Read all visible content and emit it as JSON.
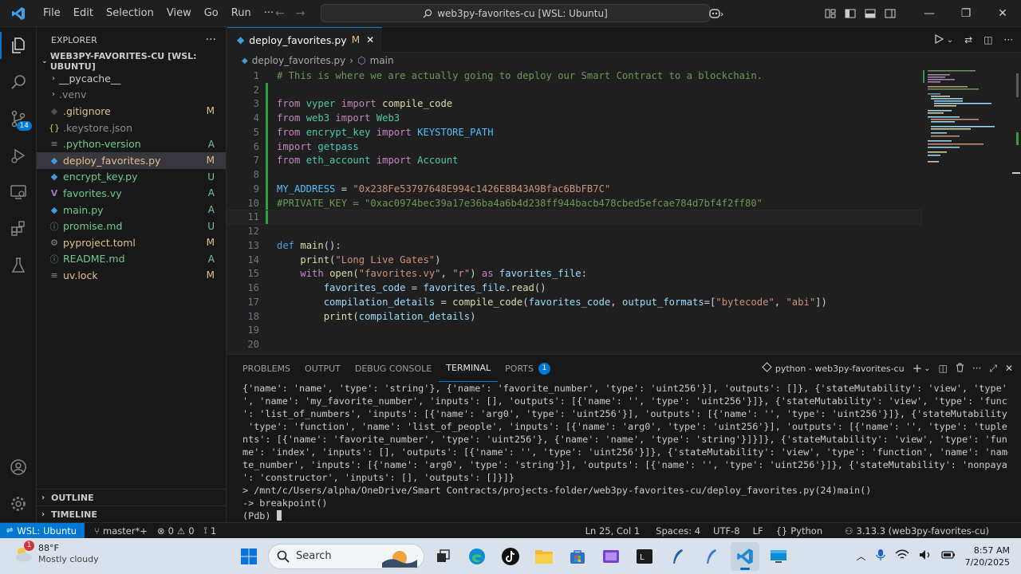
{
  "titlebar": {
    "menu": [
      "File",
      "Edit",
      "Selection",
      "View",
      "Go",
      "Run",
      "···"
    ],
    "command_center": "web3py-favorites-cu [WSL: Ubuntu]"
  },
  "activity": {
    "scm_badge": "14"
  },
  "explorer": {
    "title": "EXPLORER",
    "project": "WEB3PY-FAVORITES-CU [WSL: UBUNTU]",
    "items": [
      {
        "name": "__pycache__",
        "status": "",
        "type": "folder"
      },
      {
        "name": ".venv",
        "status": "",
        "type": "folder"
      },
      {
        "name": ".gitignore",
        "status": "M",
        "type": "git"
      },
      {
        "name": ".keystore.json",
        "status": "",
        "type": "json"
      },
      {
        "name": ".python-version",
        "status": "A",
        "type": "text"
      },
      {
        "name": "deploy_favorites.py",
        "status": "M",
        "type": "py"
      },
      {
        "name": "encrypt_key.py",
        "status": "U",
        "type": "py"
      },
      {
        "name": "favorites.vy",
        "status": "A",
        "type": "vy"
      },
      {
        "name": "main.py",
        "status": "A",
        "type": "py"
      },
      {
        "name": "promise.md",
        "status": "U",
        "type": "md"
      },
      {
        "name": "pyproject.toml",
        "status": "M",
        "type": "toml"
      },
      {
        "name": "README.md",
        "status": "A",
        "type": "md"
      },
      {
        "name": "uv.lock",
        "status": "M",
        "type": "lock"
      }
    ],
    "outline": "OUTLINE",
    "timeline": "TIMELINE"
  },
  "editor": {
    "tab_label": "deploy_favorites.py",
    "tab_status": "M",
    "breadcrumb_file": "deploy_favorites.py",
    "breadcrumb_symbol": "main",
    "line_numbers": [
      "1",
      "2",
      "3",
      "4",
      "5",
      "6",
      "7",
      "8",
      "9",
      "10",
      "11",
      "12",
      "13",
      "14",
      "15",
      "16",
      "17",
      "18",
      "19",
      "20"
    ]
  },
  "panel": {
    "tabs": [
      "PROBLEMS",
      "OUTPUT",
      "DEBUG CONSOLE",
      "TERMINAL",
      "PORTS"
    ],
    "ports_badge": "1",
    "terminal_name": "python - web3py-favorites-cu",
    "terminal_lines": [
      "{'name': 'name', 'type': 'string'}, {'name': 'favorite_number', 'type': 'uint256'}], 'outputs': []}, {'stateMutability': 'view', 'type': 'function",
      "', 'name': 'my_favorite_number', 'inputs': [], 'outputs': [{'name': '', 'type': 'uint256'}]}, {'stateMutability': 'view', 'type': 'function', 'name",
      "': 'list_of_numbers', 'inputs': [{'name': 'arg0', 'type': 'uint256'}], 'outputs': [{'name': '', 'type': 'uint256'}]}, {'stateMutability': 'view',",
      " 'type': 'function', 'name': 'list_of_people', 'inputs': [{'name': 'arg0', 'type': 'uint256'}], 'outputs': [{'name': '', 'type': 'tuple', 'compone",
      "nts': [{'name': 'favorite_number', 'type': 'uint256'}, {'name': 'name', 'type': 'string'}]}]}, {'stateMutability': 'view', 'type': 'function', 'na",
      "me': 'index', 'inputs': [], 'outputs': [{'name': '', 'type': 'uint256'}]}, {'stateMutability': 'view', 'type': 'function', 'name': 'name_to_favori",
      "te_number', 'inputs': [{'name': 'arg0', 'type': 'string'}], 'outputs': [{'name': '', 'type': 'uint256'}]}, {'stateMutability': 'nonpayable', 'type",
      "': 'constructor', 'inputs': [], 'outputs': []}]}",
      "> /mnt/c/Users/alpha/OneDrive/Smart Contracts/projects-folder/web3py-favorites-cu/deploy_favorites.py(24)main()",
      "-> breakpoint()",
      "(Pdb) "
    ]
  },
  "statusbar": {
    "remote": "WSL: Ubuntu",
    "branch": "master*+",
    "errors": "0",
    "warnings": "0",
    "ports": "1",
    "cursor_pos": "Ln 25, Col 1",
    "spaces": "Spaces: 4",
    "encoding": "UTF-8",
    "eol": "LF",
    "language": "Python",
    "interpreter": "3.13.3 (web3py-favorites-cu)"
  },
  "taskbar": {
    "weather_temp": "88°F",
    "weather_desc": "Mostly cloudy",
    "weather_badge": "1",
    "search_label": "Search",
    "time": "8:57 AM",
    "date": "7/20/2025"
  },
  "colors": {
    "accent": "#0078d4",
    "modified": "#e2c08d",
    "added": "#73c991",
    "git_gutter": "#2ea043"
  }
}
